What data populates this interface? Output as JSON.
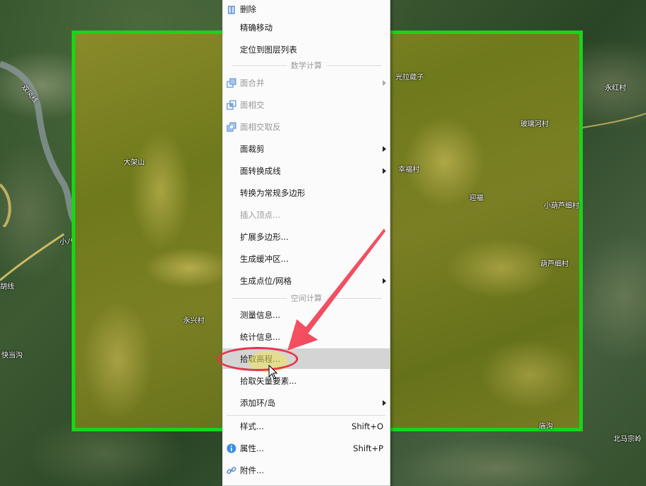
{
  "map": {
    "outer_places": [
      "双凤线",
      "小八道",
      "胡线",
      "快当沟",
      "永红村",
      "北马宗岭"
    ],
    "inner_places": [
      "大架山",
      "永兴村",
      "光拉葳子",
      "玻璃河村",
      "幸福村",
      "迎福",
      "小葫芦细村",
      "葫芦细村",
      "庙沟"
    ],
    "selection_border_color": "#19d419"
  },
  "menu": {
    "items": [
      {
        "label": "删除",
        "icon": "delete-icon",
        "enabled": true
      },
      {
        "label": "精确移动",
        "enabled": true
      },
      {
        "label": "定位到图层列表",
        "enabled": true
      }
    ],
    "section_math": "数学计算",
    "math_items": [
      {
        "label": "面合并",
        "icon": "merge-polygon-icon",
        "enabled": false,
        "submenu": true
      },
      {
        "label": "面相交",
        "icon": "intersect-polygon-icon",
        "enabled": false
      },
      {
        "label": "面相交取反",
        "icon": "symmetric-difference-icon",
        "enabled": false
      },
      {
        "label": "面裁剪",
        "enabled": true,
        "submenu": true
      },
      {
        "label": "面转换成线",
        "enabled": true,
        "submenu": true
      },
      {
        "label": "转换为常规多边形",
        "enabled": true
      },
      {
        "label": "插入顶点...",
        "enabled": false
      },
      {
        "label": "扩展多边形...",
        "enabled": true
      },
      {
        "label": "生成缓冲区...",
        "enabled": true
      },
      {
        "label": "生成点位/网格",
        "enabled": true,
        "submenu": true
      }
    ],
    "section_spatial": "空间计算",
    "spatial_items": [
      {
        "label": "测量信息...",
        "enabled": true
      },
      {
        "label": "统计信息...",
        "enabled": true
      },
      {
        "label": "拾取高程...",
        "enabled": true,
        "highlighted": true
      },
      {
        "label": "拾取矢量要素...",
        "enabled": true
      },
      {
        "label": "添加环/岛",
        "enabled": true,
        "submenu": true
      }
    ],
    "bottom_items": [
      {
        "label": "样式...",
        "shortcut": "Shift+O"
      },
      {
        "label": "属性...",
        "shortcut": "Shift+P",
        "icon": "info-icon"
      },
      {
        "label": "附件...",
        "icon": "link-icon"
      }
    ]
  },
  "annotation": {
    "arrow_color": "#f04a5a",
    "ellipse_color": "#e8334a"
  }
}
